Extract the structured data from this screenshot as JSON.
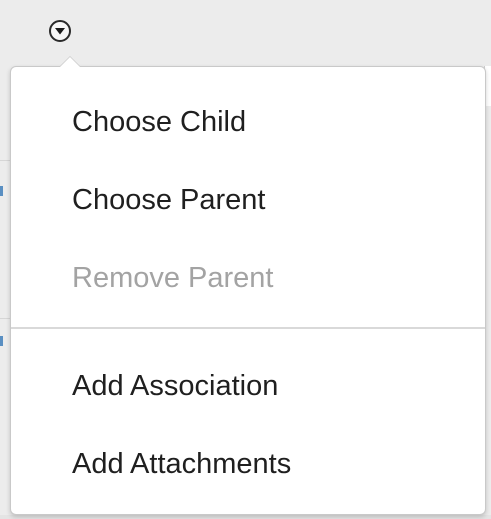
{
  "trigger": {
    "icon": "chevron-down-icon"
  },
  "menu": {
    "groups": [
      [
        {
          "label": "Choose Child",
          "enabled": true
        },
        {
          "label": "Choose Parent",
          "enabled": true
        },
        {
          "label": "Remove Parent",
          "enabled": false
        }
      ],
      [
        {
          "label": "Add Association",
          "enabled": true
        },
        {
          "label": "Add Attachments",
          "enabled": true
        }
      ]
    ]
  },
  "colors": {
    "text": "#1f1f1f",
    "disabled_text": "#a3a3a3",
    "background": "#ececec",
    "menu_background": "#ffffff",
    "divider": "#d9d9d9"
  }
}
